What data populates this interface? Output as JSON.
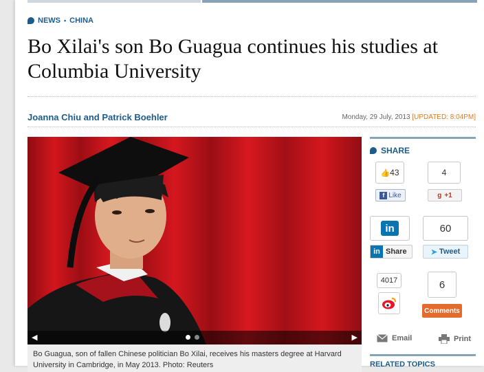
{
  "breadcrumb": {
    "section": "NEWS",
    "subsection": "CHINA"
  },
  "article": {
    "headline": "Bo Xilai's son Bo Guagua continues his studies at Columbia University",
    "byline": "Joanna Chiu and Patrick Boehler",
    "date": "Monday, 29 July, 2013",
    "updated": "[UPDATED: 8:04PM]",
    "caption": "Bo Guagua, son of fallen Chinese politician Bo Xilai, receives his masters degree at Harvard University in Cambridge, in May 2013. Photo: Reuters"
  },
  "gallery": {
    "prev": "◀",
    "next": "▶"
  },
  "share": {
    "title": "SHARE",
    "facebook_count": "43",
    "facebook_label": "Like",
    "gplus_count": "4",
    "gplus_label": "+1",
    "linkedin_logo": "in",
    "linkedin_label": "Share",
    "twitter_count": "60",
    "twitter_label": "Tweet",
    "weibo_count": "4017",
    "comments_count": "6",
    "comments_label": "Comments",
    "email_label": "Email",
    "print_label": "Print"
  },
  "sidebar": {
    "related_title": "RELATED TOPICS"
  },
  "colors": {
    "brand_blue": "#1d5c8a",
    "accent_orange": "#e07a21",
    "photo_red": "#c8141c"
  }
}
